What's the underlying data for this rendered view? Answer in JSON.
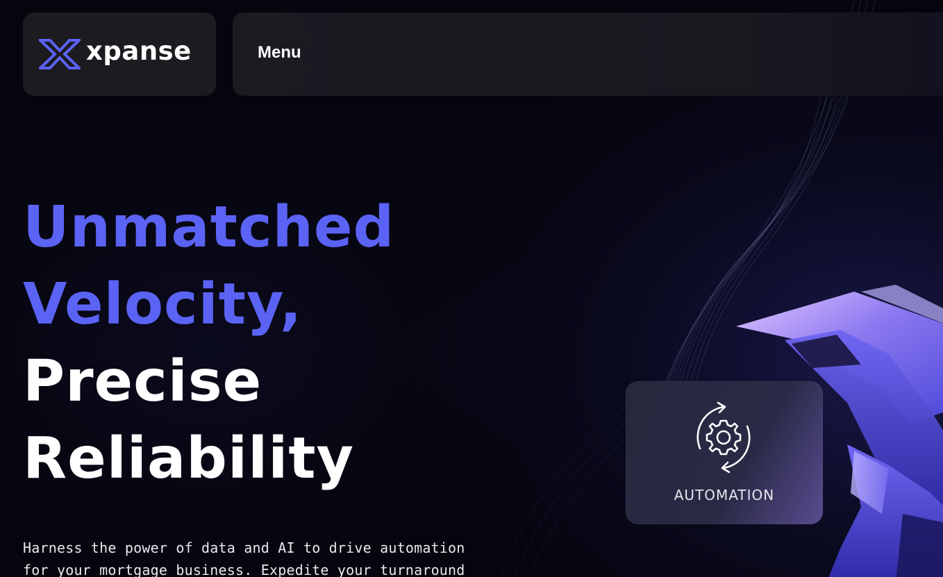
{
  "brand": {
    "name": "xpanse",
    "accent_color": "#5b63f5",
    "logo_icon": "x-logo-icon"
  },
  "nav": {
    "menu_label": "Menu"
  },
  "hero": {
    "line1": "Unmatched",
    "line2": "Velocity,",
    "line3": "Precise",
    "line4": "Reliability",
    "description": "Harness the power of data and AI to drive automation for your mortgage business. Expedite your turnaround"
  },
  "feature_card": {
    "icon": "gear-cycle-icon",
    "label": "AUTOMATION"
  }
}
